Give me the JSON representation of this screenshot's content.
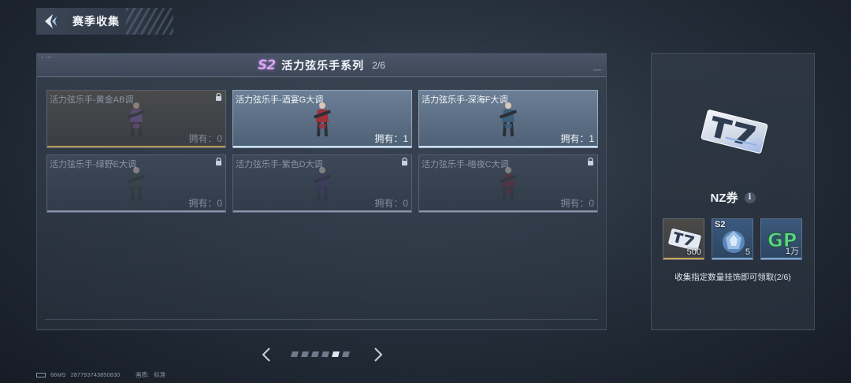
{
  "header": {
    "title": "赛季收集"
  },
  "panel": {
    "season_badge": "S2",
    "series_title": "活力弦乐手系列",
    "progress": "2/6"
  },
  "cards": [
    {
      "name": "活力弦乐手-黄金AB调",
      "owned": "拥有：0",
      "locked": true,
      "rarity": "gold",
      "color": "#7a58a8"
    },
    {
      "name": "活力弦乐手-酒宴G大调",
      "owned": "拥有：1",
      "locked": false,
      "rarity": "owned",
      "color": "#a0303a"
    },
    {
      "name": "活力弦乐手-深海F大调",
      "owned": "拥有：1",
      "locked": false,
      "rarity": "owned",
      "color": "#3b5f7a"
    },
    {
      "name": "活力弦乐手-绿野E大调",
      "owned": "拥有：0",
      "locked": true,
      "rarity": "locked",
      "color": "#3a4a3e"
    },
    {
      "name": "活力弦乐手-紫色D大调",
      "owned": "拥有：0",
      "locked": true,
      "rarity": "locked",
      "color": "#45386a"
    },
    {
      "name": "活力弦乐手-暗夜C大调",
      "owned": "拥有：0",
      "locked": true,
      "rarity": "locked",
      "color": "#6a2a34"
    }
  ],
  "pager": {
    "count": 6,
    "active_index": 4
  },
  "reward": {
    "name": "NZ券",
    "info_icon": "i",
    "items": [
      {
        "tag": "",
        "amount": "500",
        "icon": "nz-ticket-icon",
        "bar_color": "#c9a455"
      },
      {
        "tag": "S2",
        "amount": "5",
        "icon": "s2-crystal-icon",
        "bar_color": "#7fa8d0"
      },
      {
        "tag": "",
        "amount": "1万",
        "icon": "gp-coin-icon",
        "bar_color": "#7fa8d0"
      }
    ],
    "description": "收集指定数量挂饰即可领取(2/6)"
  },
  "footer": {
    "ping": "66MS",
    "uid": "287793743850830",
    "quality_label": "画质:",
    "quality_value": "标准"
  }
}
